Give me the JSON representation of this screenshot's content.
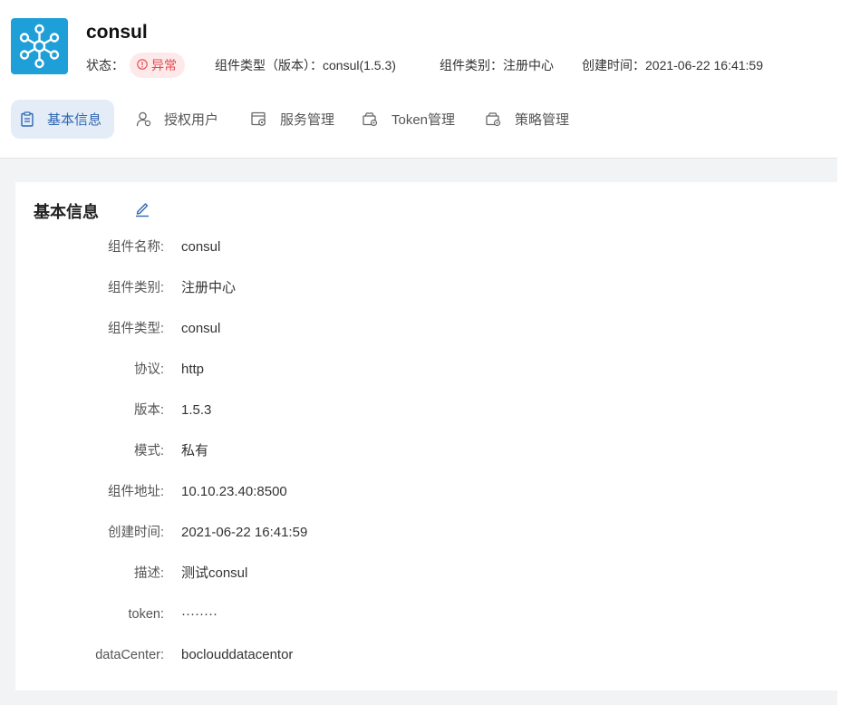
{
  "header": {
    "logo_icon": "network-nodes-icon",
    "title": "consul",
    "status_label": "状态：",
    "status_value": "异常",
    "status_icon": "alert-circle-icon",
    "type_text": "组件类型（版本）：consul(1.5.3)",
    "category_text": "组件类别：注册中心",
    "created_text": "创建时间：2021-06-22 16:41:59"
  },
  "tabs": [
    {
      "label": "基本信息",
      "icon": "clipboard-icon",
      "active": true
    },
    {
      "label": "授权用户",
      "icon": "user-icon",
      "active": false
    },
    {
      "label": "服务管理",
      "icon": "service-icon",
      "active": false
    },
    {
      "label": "Token管理",
      "icon": "token-icon",
      "active": false
    },
    {
      "label": "策略管理",
      "icon": "policy-icon",
      "active": false
    }
  ],
  "card": {
    "title": "基本信息",
    "edit_icon": "edit-icon",
    "fields": [
      {
        "label": "组件名称:",
        "value": "consul"
      },
      {
        "label": "组件类别:",
        "value": "注册中心"
      },
      {
        "label": "组件类型:",
        "value": "consul"
      },
      {
        "label": "协议:",
        "value": "http"
      },
      {
        "label": "版本:",
        "value": "1.5.3"
      },
      {
        "label": "模式:",
        "value": "私有"
      },
      {
        "label": "组件地址:",
        "value": "10.10.23.40:8500"
      },
      {
        "label": "创建时间:",
        "value": "2021-06-22 16:41:59"
      },
      {
        "label": "描述:",
        "value": "测试consul"
      },
      {
        "label": "token:",
        "value": "········"
      },
      {
        "label": "dataCenter:",
        "value": "boclouddatacentor"
      }
    ]
  },
  "colors": {
    "accent": "#2f66b3",
    "logo_bg": "#1f9fd8",
    "status_error": "#e5484d",
    "status_error_bg": "#fde9e9",
    "page_bg": "#f2f3f5"
  }
}
